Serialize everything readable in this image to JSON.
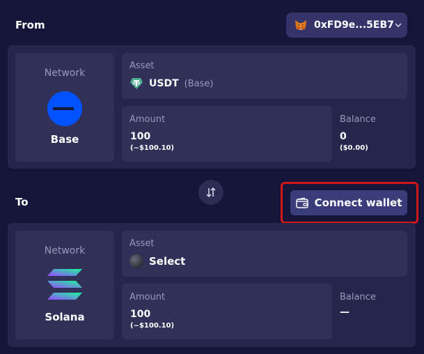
{
  "from": {
    "label": "From",
    "wallet_address": "0xFD9e...5EB7",
    "network_label": "Network",
    "network_name": "Base",
    "asset_label": "Asset",
    "asset_name": "USDT",
    "asset_chain": "(Base)",
    "amount_label": "Amount",
    "amount_value": "100",
    "amount_usd": "(~$100.10)",
    "balance_label": "Balance",
    "balance_value": "0",
    "balance_usd": "($0.00)"
  },
  "to": {
    "label": "To",
    "connect_label": "Connect wallet",
    "network_label": "Network",
    "network_name": "Solana",
    "asset_label": "Asset",
    "asset_name": "Select",
    "amount_label": "Amount",
    "amount_value": "100",
    "amount_usd": "(~$100.10)",
    "balance_label": "Balance",
    "balance_value": "—"
  },
  "icons": {
    "wallet_pill": "metamask-fox-icon",
    "wallet_chevron": "chevron-down-icon",
    "swap": "swap-arrows-icon",
    "connect": "wallet-icon",
    "from_network": "base-logo-icon",
    "to_network": "solana-logo-icon",
    "from_asset": "tether-icon",
    "to_asset": "placeholder-token-icon"
  },
  "colors": {
    "background": "#15153a",
    "panel": "#26264d",
    "card": "#303058",
    "base_blue": "#0052ff",
    "tether_green": "#50af95",
    "highlight_red": "#d01818",
    "button": "#3b3c7a"
  }
}
